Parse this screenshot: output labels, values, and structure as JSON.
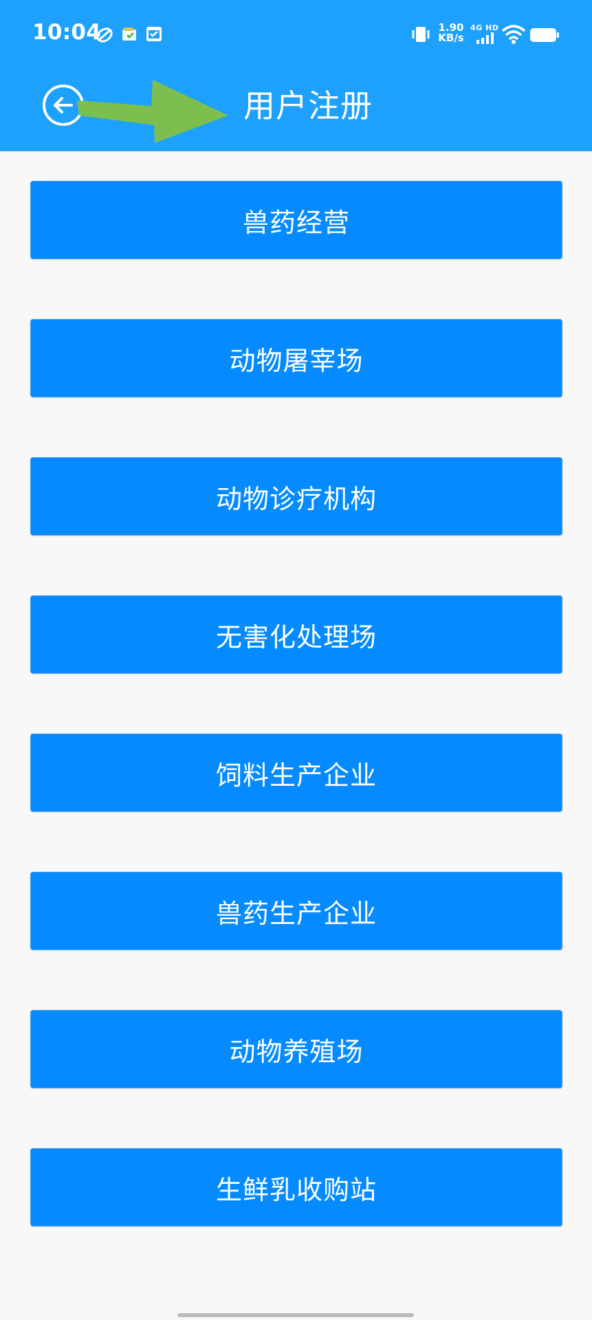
{
  "status_bar": {
    "time": "10:04",
    "net_speed_value": "1.90",
    "net_speed_unit": "KB/s",
    "signal_label": "4G HD",
    "icons": [
      "sync-icon",
      "wallet-icon",
      "calendar-icon",
      "vibrate-icon",
      "signal-icon",
      "wifi-icon",
      "battery-icon"
    ]
  },
  "header": {
    "title": "用户注册",
    "back_icon": "back-arrow-icon",
    "annotation_icon": "green-arrow-annotation",
    "color": "#1da1fc"
  },
  "registration_options": [
    {
      "label": "兽药经营"
    },
    {
      "label": "动物屠宰场"
    },
    {
      "label": "动物诊疗机构"
    },
    {
      "label": "无害化处理场"
    },
    {
      "label": "饲料生产企业"
    },
    {
      "label": "兽药生产企业"
    },
    {
      "label": "动物养殖场"
    },
    {
      "label": "生鲜乳收购站"
    }
  ],
  "colors": {
    "button": "#058bff",
    "background": "#f8f8f8",
    "annotation": "#7cbf4f"
  }
}
